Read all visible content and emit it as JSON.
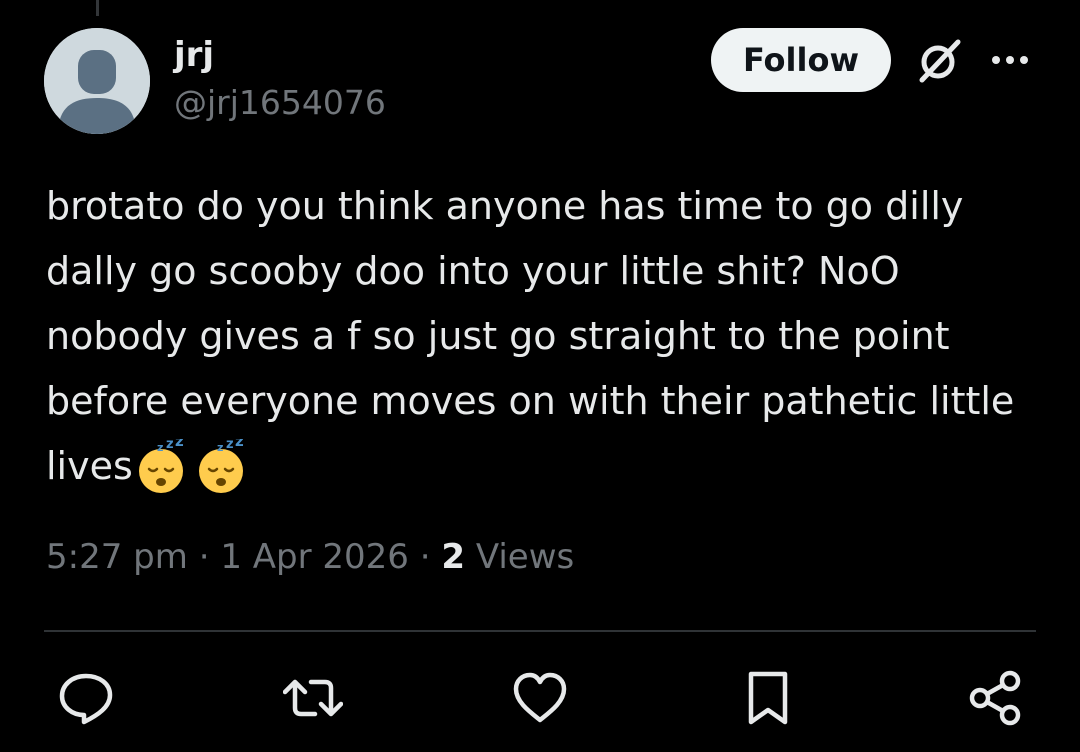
{
  "tweet": {
    "author": {
      "display_name": "jrj",
      "handle": "@jrj1654076",
      "avatar_icon": "default-avatar-icon"
    },
    "follow_label": "Follow",
    "text": "brotato do you think anyone has time to go dilly dally go scooby doo into your little shit? NoO nobody gives a f so just go straight to the point before everyone moves on with their pathetic little lives",
    "emojis": [
      "sleeping-face-emoji",
      "sleeping-face-emoji"
    ],
    "time": "5:27 pm",
    "date": "1 Apr 2026",
    "separator": "·",
    "views_count": "2",
    "views_label": "Views"
  },
  "actions": [
    {
      "name": "reply-icon"
    },
    {
      "name": "retweet-icon"
    },
    {
      "name": "like-icon"
    },
    {
      "name": "bookmark-icon"
    },
    {
      "name": "share-icon"
    }
  ],
  "colors": {
    "background": "#000000",
    "text_primary": "#e7e9ea",
    "text_secondary": "#71767b",
    "divider": "#2f3336",
    "follow_bg": "#eff3f4",
    "emoji_yellow": "#ffcc4d"
  }
}
